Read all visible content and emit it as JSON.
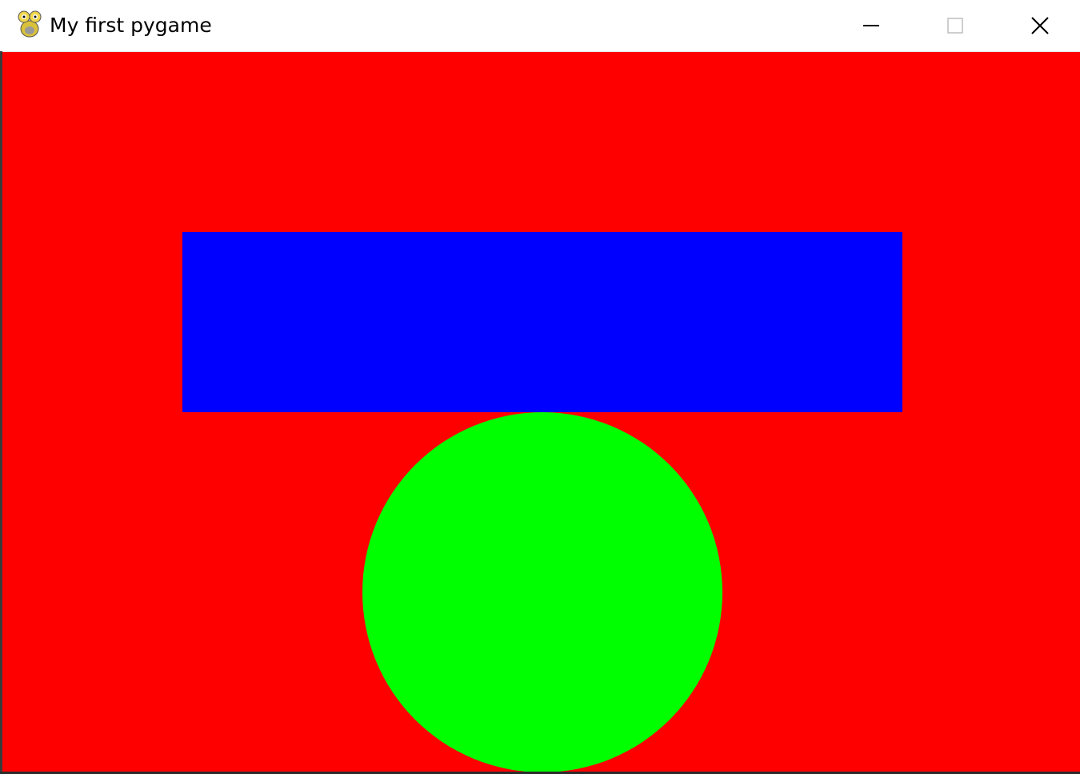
{
  "window": {
    "title": "My first pygame",
    "app_icon": "pygame-snake-icon",
    "controls": {
      "minimize_icon": "minimize-icon",
      "maximize_icon": "maximize-icon",
      "close_icon": "close-icon"
    }
  },
  "canvas": {
    "background_color": "#ff0000",
    "shapes": [
      {
        "type": "rectangle",
        "color": "#0000ff"
      },
      {
        "type": "circle",
        "color": "#00ff00"
      }
    ]
  }
}
